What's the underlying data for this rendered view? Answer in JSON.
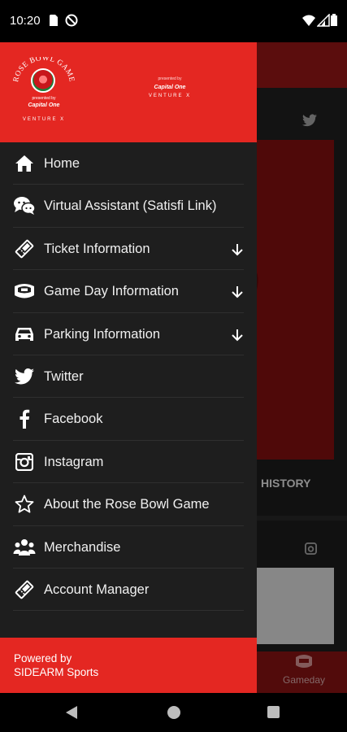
{
  "status_bar": {
    "time": "10:20",
    "icons": [
      "sd-card-icon",
      "do-not-disturb-icon",
      "wifi-icon",
      "signal-icon",
      "battery-icon"
    ]
  },
  "background_app": {
    "history_label": "HISTORY",
    "tab_gameday_label": "Gameday"
  },
  "drawer": {
    "header": {
      "logo_title": "ROSE BOWL GAME",
      "logo_presented": "presented by",
      "logo_sponsor": "Capital One",
      "logo_venture": "VENTURE X",
      "sponsor_presented": "presented by",
      "sponsor_name": "Capital One",
      "sponsor_venture": "VENTURE X"
    },
    "menu": [
      {
        "label": "Home",
        "icon": "home-icon",
        "expandable": false
      },
      {
        "label": "Virtual Assistant (Satisfi Link)",
        "icon": "chat-icon",
        "expandable": false
      },
      {
        "label": "Ticket Information",
        "icon": "ticket-icon",
        "expandable": true
      },
      {
        "label": "Game Day Information",
        "icon": "stadium-icon",
        "expandable": true
      },
      {
        "label": "Parking Information",
        "icon": "car-icon",
        "expandable": true
      },
      {
        "label": "Twitter",
        "icon": "twitter-icon",
        "expandable": false
      },
      {
        "label": "Facebook",
        "icon": "facebook-icon",
        "expandable": false
      },
      {
        "label": "Instagram",
        "icon": "instagram-icon",
        "expandable": false
      },
      {
        "label": "About the Rose Bowl Game",
        "icon": "star-icon",
        "expandable": false
      },
      {
        "label": "Merchandise",
        "icon": "people-icon",
        "expandable": false
      },
      {
        "label": "Account Manager",
        "icon": "ticket-icon",
        "expandable": false
      }
    ],
    "footer": {
      "line1": "Powered by",
      "line2": "SIDEARM Sports"
    }
  },
  "colors": {
    "brand_red": "#e42722",
    "drawer_bg": "#1e1e1e",
    "dark_red": "#8c1414"
  }
}
